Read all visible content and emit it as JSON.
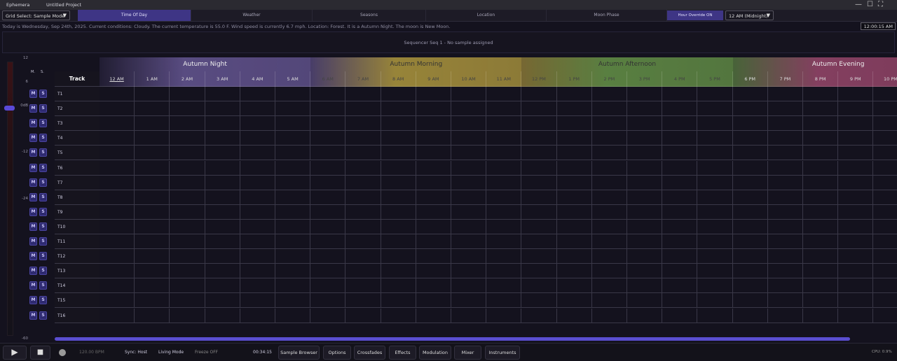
{
  "app": {
    "name": "Ephemera",
    "project": "Untitled Project"
  },
  "tabbar": {
    "grid_select": "Grid Select: Sample Mode",
    "tabs": [
      "Time Of Day",
      "Weather",
      "Seasons",
      "Location",
      "Moon Phase"
    ],
    "active_tab": "Time Of Day",
    "hour_override": "Hour Override ON",
    "hour_select": "12 AM (Midnight)"
  },
  "info": "Today is Wednesday, Sep 24th, 2025. Current conditions: Cloudy. The current temperature is 55.0 F. Wind speed is currently 6.7 mph. Location: Forest. It is a Autumn Night. The moon is New Moon.",
  "clock": "12:00:15 AM",
  "sequencer": "Sequencer Seq 1 - No sample assigned",
  "meter": {
    "labels": [
      "12",
      "6",
      "0dB",
      "-12",
      "-24",
      "-60"
    ],
    "level_db": 0,
    "mute_header": "M.",
    "solo_header": "S."
  },
  "grid": {
    "track_header": "Track",
    "groups": [
      {
        "label": "Autumn Night",
        "color": "#6a5a9a"
      },
      {
        "label": "Autumn Morning",
        "color": "#b8a040"
      },
      {
        "label": "Autumn Afternoon",
        "color": "#6a9a4a"
      },
      {
        "label": "Autumn Evening",
        "color": "#a04a70"
      }
    ],
    "hours": [
      "12 AM",
      "1 AM",
      "2 AM",
      "3 AM",
      "4 AM",
      "5 AM",
      "6 AM",
      "7 AM",
      "8 AM",
      "9 AM",
      "10 AM",
      "11 AM",
      "12 PM",
      "1 PM",
      "2 PM",
      "3 PM",
      "4 PM",
      "5 PM",
      "6 PM",
      "7 PM",
      "8 PM",
      "9 PM",
      "10 PM"
    ],
    "current_hour": "12 AM",
    "tracks": [
      "T1",
      "T2",
      "T3",
      "T4",
      "T5",
      "T6",
      "T7",
      "T8",
      "T9",
      "T10",
      "T11",
      "T12",
      "T13",
      "T14",
      "T15",
      "T16"
    ],
    "mute_label": "M",
    "solo_label": "S"
  },
  "transport": {
    "bpm": "120.00 BPM",
    "sync": "Sync: Host",
    "mode": "Living Mode",
    "freeze": "Freeze OFF",
    "time": "00:34:15",
    "buttons": [
      "Sample Browser",
      "Options",
      "Crossfades",
      "Effects",
      "Modulation",
      "Mixer",
      "Instruments"
    ],
    "cpu": "CPU: 0.9%"
  },
  "colors": {
    "accent": "#3e3585",
    "background": "#14121e"
  }
}
